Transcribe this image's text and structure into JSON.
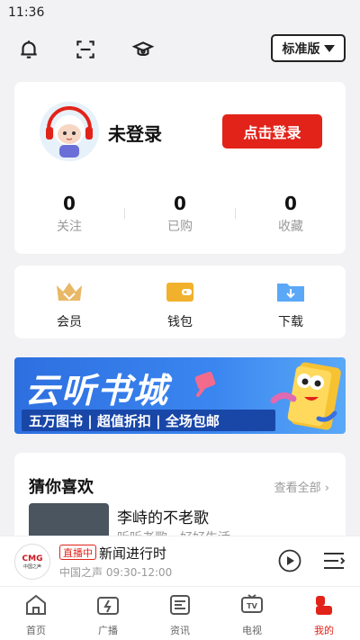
{
  "status_bar": {
    "time": "11:36"
  },
  "header": {
    "edition_label": "标准版"
  },
  "profile": {
    "username": "未登录",
    "login_label": "点击登录",
    "stats": [
      {
        "value": "0",
        "label": "关注"
      },
      {
        "value": "0",
        "label": "已购"
      },
      {
        "value": "0",
        "label": "收藏"
      }
    ]
  },
  "menu": [
    {
      "label": "会员",
      "icon": "crown-icon"
    },
    {
      "label": "钱包",
      "icon": "wallet-icon"
    },
    {
      "label": "下载",
      "icon": "download-folder-icon"
    }
  ],
  "banner": {
    "title": "云听书城",
    "subtitle": "五万图书 | 超值折扣 | 全场包邮"
  },
  "recommend": {
    "title": "猜你喜欢",
    "more_label": "查看全部",
    "item_title": "李峙的不老歌",
    "item_subtitle": "听听老歌，好好生活"
  },
  "player": {
    "logo_text": "CMG",
    "logo_sub": "中国之声",
    "live_badge": "直播中",
    "title": "新闻进行时",
    "subtitle": "中国之声 09:30-12:00"
  },
  "tabs": [
    {
      "label": "首页",
      "icon": "home-icon"
    },
    {
      "label": "广播",
      "icon": "radio-icon"
    },
    {
      "label": "资讯",
      "icon": "news-icon"
    },
    {
      "label": "电视",
      "icon": "tv-icon"
    },
    {
      "label": "我的",
      "icon": "profile-icon",
      "active": true
    }
  ],
  "colors": {
    "accent": "#e2231a",
    "banner": "#3a86f0"
  }
}
